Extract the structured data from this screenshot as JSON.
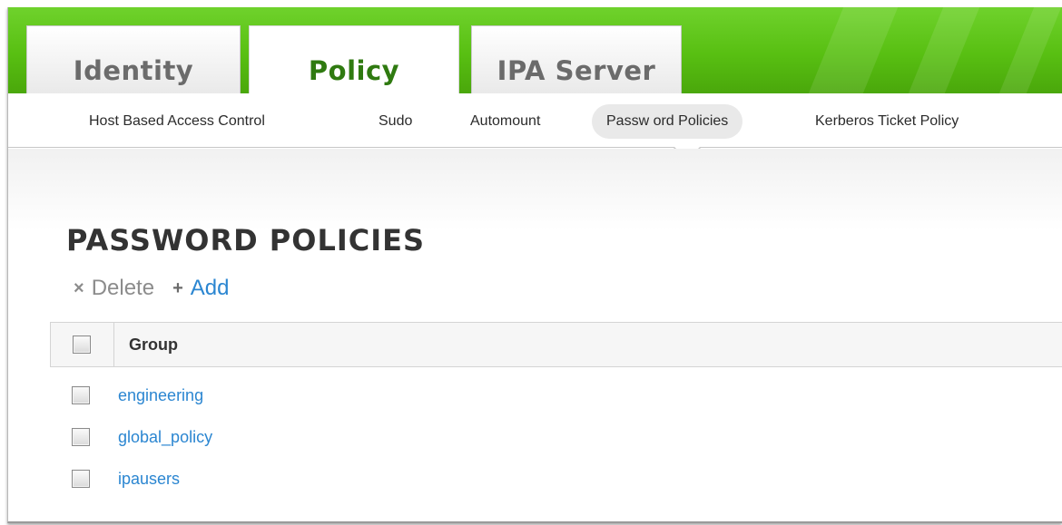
{
  "tabs": [
    {
      "label": "Identity",
      "active": false
    },
    {
      "label": "Policy",
      "active": true
    },
    {
      "label": "IPA Server",
      "active": false
    }
  ],
  "subnav": [
    {
      "label": "Host Based Access Control",
      "active": false
    },
    {
      "label": "Sudo",
      "active": false
    },
    {
      "label": "Automount",
      "active": false
    },
    {
      "label": "Passw ord Policies",
      "active": true
    },
    {
      "label": "Kerberos Ticket Policy",
      "active": false
    }
  ],
  "page": {
    "title": "PASSWORD POLICIES"
  },
  "actions": {
    "delete_label": "Delete",
    "add_label": "Add",
    "delete_icon": "×",
    "add_icon": "+"
  },
  "table": {
    "columns": [
      "Group"
    ],
    "rows": [
      {
        "group": "engineering",
        "checked": false
      },
      {
        "group": "global_policy",
        "checked": false
      },
      {
        "group": "ipausers",
        "checked": false
      }
    ]
  },
  "colors": {
    "brand_green": "#58bf12",
    "active_tab_text": "#2f7a10",
    "link_blue": "#2b86d1"
  }
}
